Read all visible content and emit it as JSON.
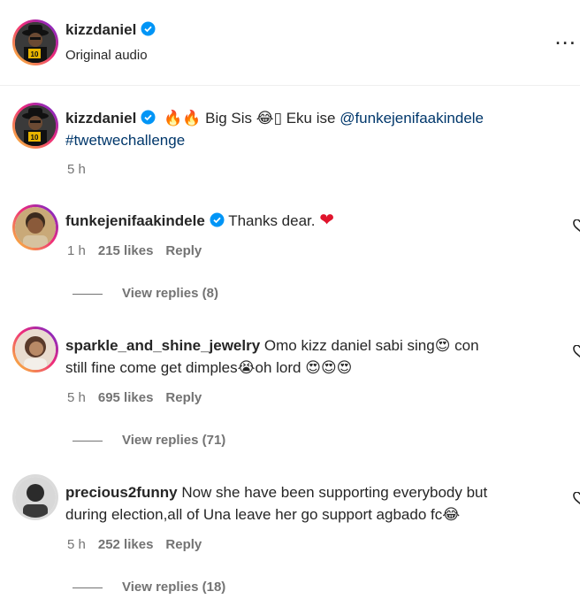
{
  "post": {
    "username": "kizzdaniel",
    "audio": "Original audio",
    "more_label": "..."
  },
  "caption": {
    "username": "kizzdaniel",
    "emoji_prefix": "🔥🔥",
    "text_a": " Big Sis ",
    "emoji_mid": "😂",
    "box_char": "▯",
    "text_b": " Eku ise ",
    "mention": "@funkejenifaakindele",
    "hashtag": "#twetwechallenge",
    "time": "5 h"
  },
  "comments": [
    {
      "username": "funkejenifaakindele",
      "verified": true,
      "text": "Thanks dear. ",
      "emoji": "❤",
      "time": "1 h",
      "likes": "215 likes",
      "reply": "Reply",
      "view_replies": "View replies (8)"
    },
    {
      "username": "sparkle_and_shine_jewelry",
      "text_line1": "Omo kizz daniel sabi sing",
      "emoji1": "😍",
      "text_line1b": " con",
      "text_line2": "still fine come get dimples",
      "emoji2": "😭",
      "text_line2b": "oh lord ",
      "emoji3": "😍😍😍",
      "time": "5 h",
      "likes": "695 likes",
      "reply": "Reply",
      "view_replies": "View replies (71)"
    },
    {
      "username": "precious2funny",
      "text_line1": "Now she have been supporting everybody but",
      "text_line2": "during election,all of Una leave her go support agbado fc",
      "emoji": "😂",
      "time": "5 h",
      "likes": "252 likes",
      "reply": "Reply",
      "view_replies": "View replies (18)"
    }
  ],
  "colors": {
    "verified": "#0095f6",
    "link": "#00376b",
    "meta": "#737373",
    "heart": "#ed4956"
  }
}
